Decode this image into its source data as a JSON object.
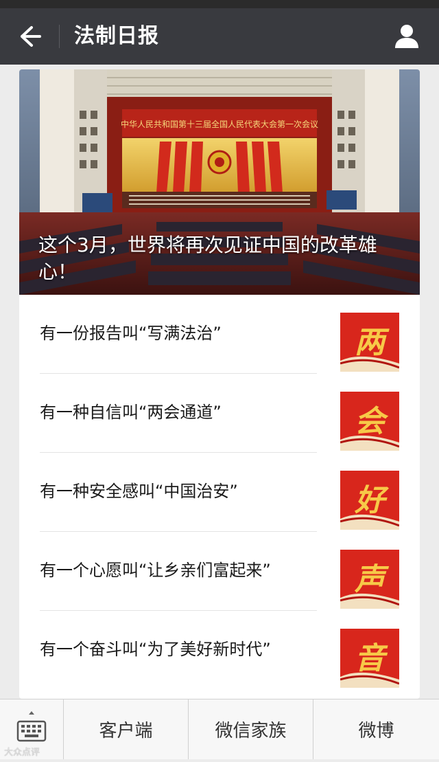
{
  "header": {
    "title": "法制日报",
    "back_icon": "back-arrow-icon",
    "profile_icon": "person-icon"
  },
  "hero": {
    "title": "这个3月，世界将再次见证中国的改革雄心！",
    "banner_text": "中华人民共和国第十三届全国人民代表大会第一次会议"
  },
  "articles": [
    {
      "title": "有一份报告叫“写满法治”",
      "thumb_char": "两"
    },
    {
      "title": "有一种自信叫“两会通道”",
      "thumb_char": "会"
    },
    {
      "title": "有一种安全感叫“中国治安”",
      "thumb_char": "好"
    },
    {
      "title": "有一个心愿叫“让乡亲们富起来”",
      "thumb_char": "声"
    },
    {
      "title": "有一个奋斗叫“为了美好新时代”",
      "thumb_char": "音"
    }
  ],
  "bottom_menu": {
    "keyboard_icon": "keyboard-icon",
    "items": [
      "客户端",
      "微信家族",
      "微博"
    ]
  },
  "watermark": "大众点评",
  "colors": {
    "navbar": "#393a3f",
    "thumb_red": "#d8261c",
    "thumb_gold": "#f7c948"
  }
}
